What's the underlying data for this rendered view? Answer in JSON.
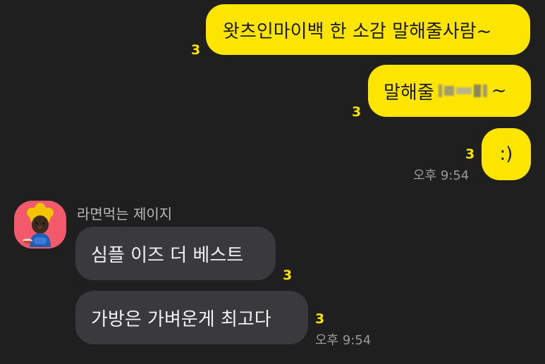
{
  "messages_sent": [
    {
      "text": "왓츠인마이백 한 소감 말해줄사람~",
      "unread": "3"
    },
    {
      "text_before": "말해줄 ",
      "redacted_note": "pixelated name",
      "text_after": "~",
      "unread": "3"
    },
    {
      "text": ":)",
      "unread": "3",
      "time": "오후 9:54"
    }
  ],
  "friend": {
    "name": "라면먹는 제이지",
    "avatar": "jay-g-character-avatar",
    "avatar_color": "#f2596b"
  },
  "messages_received": [
    {
      "text": "심플 이즈 더 베스트",
      "unread": "3"
    },
    {
      "text": "가방은 가벼운게 최고다",
      "unread": "3",
      "time": "오후 9:54"
    }
  ],
  "colors": {
    "background": "#1f1f20",
    "my_bubble": "#fee500",
    "their_bubble": "#3a3a3c",
    "unread_count": "#fee500"
  }
}
